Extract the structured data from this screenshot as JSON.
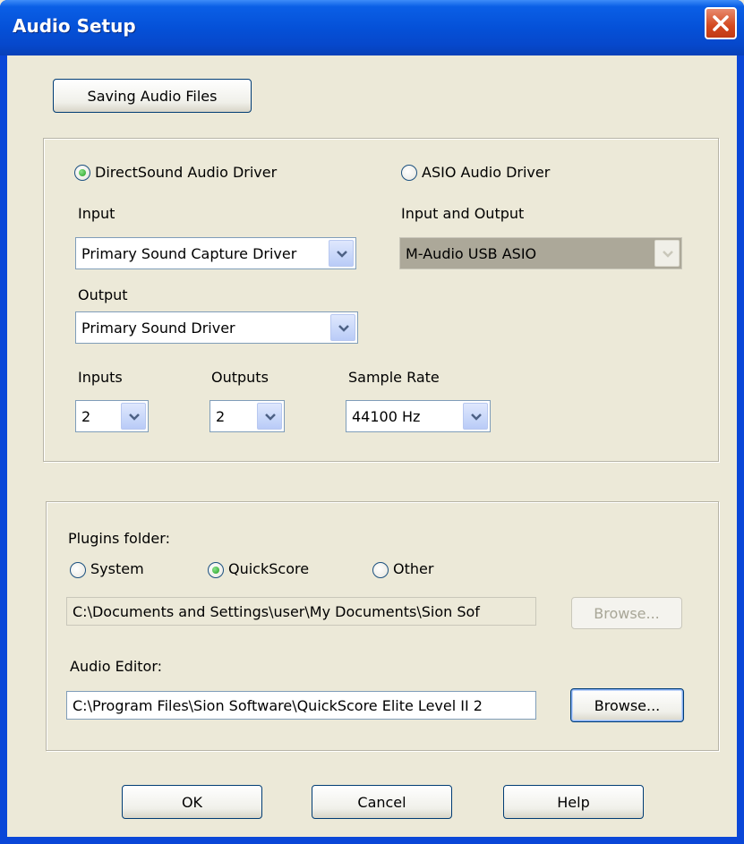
{
  "window": {
    "title": "Audio Setup"
  },
  "buttons": {
    "saving_audio_files": "Saving Audio Files",
    "plugins_browse": "Browse...",
    "editor_browse": "Browse...",
    "ok": "OK",
    "cancel": "Cancel",
    "help": "Help"
  },
  "driver": {
    "directsound_label": "DirectSound Audio Driver",
    "asio_label": "ASIO Audio Driver",
    "selected": "DirectSound Audio Driver",
    "input_label": "Input",
    "input_value": "Primary Sound Capture Driver",
    "output_label": "Output",
    "output_value": "Primary Sound Driver",
    "asio_io_label": "Input and Output",
    "asio_io_value": "M-Audio USB ASIO",
    "inputs_label": "Inputs",
    "inputs_value": "2",
    "outputs_label": "Outputs",
    "outputs_value": "2",
    "sample_rate_label": "Sample Rate",
    "sample_rate_value": "44100 Hz"
  },
  "plugins": {
    "folder_label": "Plugins folder:",
    "options": [
      "System",
      "QuickScore",
      "Other"
    ],
    "selected": "QuickScore",
    "path": "C:\\Documents and Settings\\user\\My Documents\\Sion Sof"
  },
  "editor": {
    "label": "Audio Editor:",
    "path": "C:\\Program Files\\Sion Software\\QuickScore Elite Level II 2"
  },
  "colors": {
    "titlebar": "#0551d8",
    "face": "#ece9d8",
    "close": "#d3481f"
  }
}
